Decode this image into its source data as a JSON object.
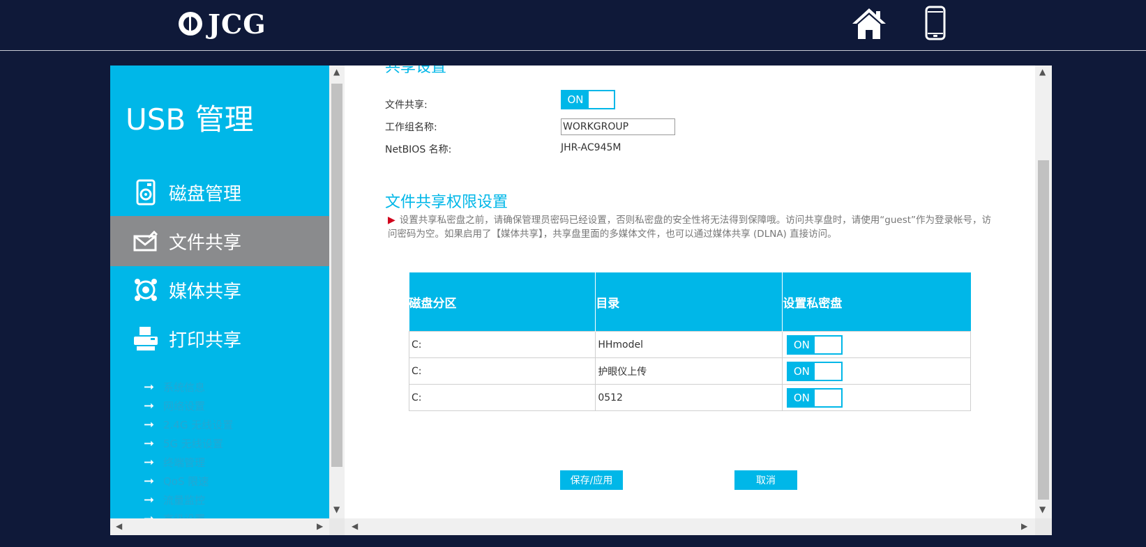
{
  "header": {
    "brand": "JCG",
    "home_icon": "home-icon",
    "mobile_icon": "mobile-phone-icon"
  },
  "sidebar": {
    "title": "USB 管理",
    "items": [
      {
        "label": "磁盘管理",
        "icon": "disk-icon"
      },
      {
        "label": "文件共享",
        "icon": "file-share-icon",
        "active": true
      },
      {
        "label": "媒体共享",
        "icon": "media-share-icon"
      },
      {
        "label": "打印共享",
        "icon": "printer-icon"
      }
    ],
    "sub_items": [
      {
        "label": "系统信息"
      },
      {
        "label": "网络设置"
      },
      {
        "label": "2.4G 无线设置"
      },
      {
        "label": "5G 无线设置"
      },
      {
        "label": "终端管理"
      },
      {
        "label": "QoS 限速"
      },
      {
        "label": "流量监控"
      },
      {
        "label": "高级设置"
      }
    ]
  },
  "share_settings": {
    "title": "共享设置",
    "file_share_label": "文件共享:",
    "file_share_state": "ON",
    "workgroup_label": "工作组名称:",
    "workgroup_value": "WORKGROUP",
    "netbios_label": "NetBIOS 名称:",
    "netbios_value": "JHR-AC945M"
  },
  "permission_settings": {
    "title": "文件共享权限设置",
    "note": "设置共享私密盘之前，请确保管理员密码已经设置，否则私密盘的安全性将无法得到保障哦。访问共享盘时，请使用“guest”作为登录帐号，访问密码为空。如果启用了【媒体共享】，共享盘里面的多媒体文件，也可以通过媒体共享 (DLNA) 直接访问。",
    "columns": [
      "磁盘分区",
      "目录",
      "设置私密盘"
    ],
    "rows": [
      {
        "partition": "C:",
        "directory": "HHmodel",
        "private": "ON"
      },
      {
        "partition": "C:",
        "directory": "护眼仪上传",
        "private": "ON"
      },
      {
        "partition": "C:",
        "directory": "0512",
        "private": "ON"
      }
    ]
  },
  "buttons": {
    "save": "保存/应用",
    "cancel": "取消"
  },
  "colors": {
    "background": "#0f1939",
    "accent": "#00b7e8",
    "active_menu": "#8a8b8d"
  }
}
